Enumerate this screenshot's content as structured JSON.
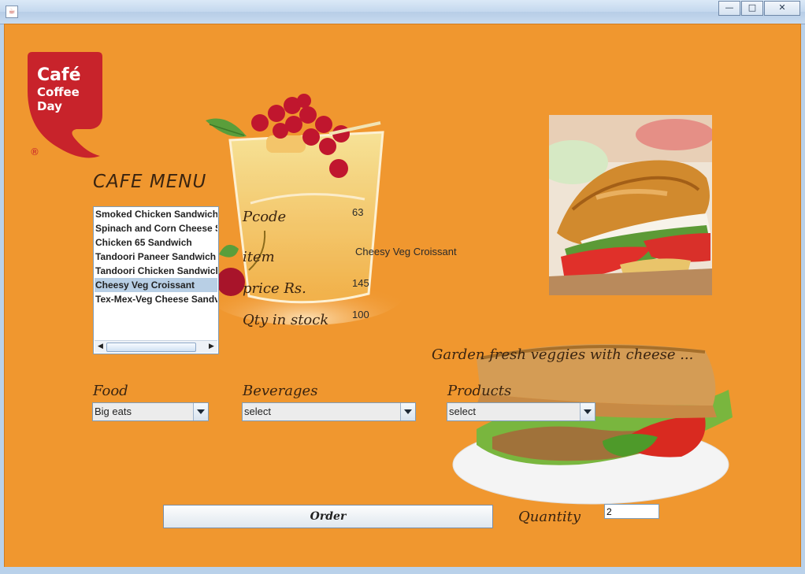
{
  "window": {
    "minimize": "—",
    "maximize": "□",
    "close": "✕"
  },
  "logo": {
    "line1": "Café",
    "line2": "Coffee",
    "line3": "Day",
    "reg": "®"
  },
  "menu": {
    "title": "CAFE MENU",
    "items": [
      "Smoked Chicken Sandwich",
      "Spinach and Corn Cheese S",
      "Chicken 65 Sandwich",
      "Tandoori Paneer Sandwich",
      "Tandoori Chicken Sandwich",
      "Cheesy Veg Croissant",
      "Tex-Mex-Veg Cheese Sandv"
    ],
    "selected_index": 5
  },
  "details": {
    "pcode_label": "Pcode",
    "pcode_value": "63",
    "item_label": "item",
    "item_value": "Cheesy Veg Croissant",
    "price_label": "price Rs.",
    "price_value": "145",
    "qty_label": "Qty in stock",
    "qty_value": "100"
  },
  "tagline": "Garden fresh veggies with cheese ...",
  "food": {
    "label": "Food",
    "value": "Big eats"
  },
  "beverages": {
    "label": "Beverages",
    "value": "select"
  },
  "products": {
    "label": "Products",
    "value": "select"
  },
  "order_label": "Order",
  "quantity": {
    "label": "Quantity",
    "value": "2"
  },
  "colors": {
    "background": "#f0972f",
    "logo_red": "#c8232b"
  }
}
